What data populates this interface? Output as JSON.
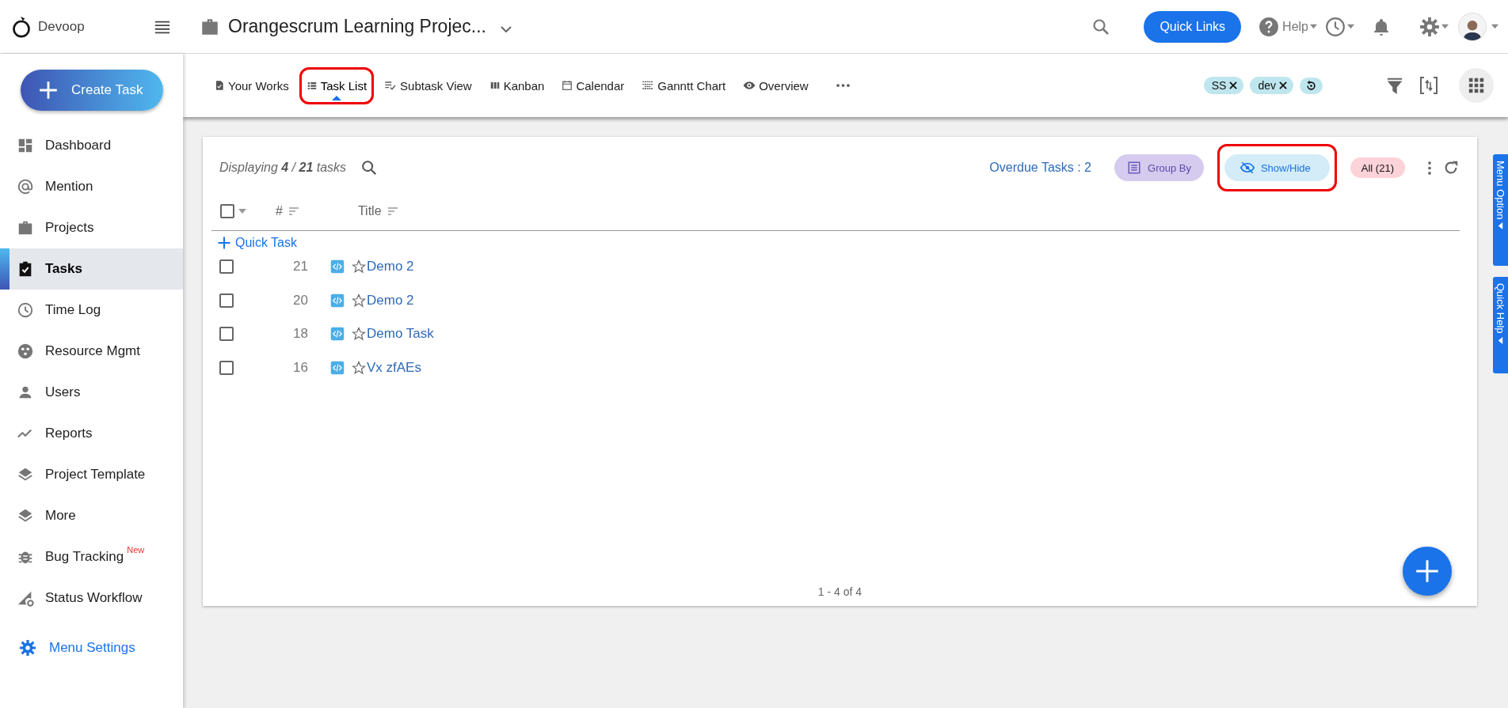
{
  "app": {
    "name": "Devoop"
  },
  "topbar": {
    "project_title": "Orangescrum Learning Projec...",
    "quick_links": "Quick Links",
    "help": "Help"
  },
  "sidebar": {
    "create_button": "Create Task",
    "items": [
      {
        "label": "Dashboard",
        "selected": false
      },
      {
        "label": "Mention",
        "selected": false
      },
      {
        "label": "Projects",
        "selected": false
      },
      {
        "label": "Tasks",
        "selected": true
      },
      {
        "label": "Time Log",
        "selected": false
      },
      {
        "label": "Resource Mgmt",
        "selected": false
      },
      {
        "label": "Users",
        "selected": false
      },
      {
        "label": "Reports",
        "selected": false
      },
      {
        "label": "Project Template",
        "selected": false
      },
      {
        "label": "More",
        "selected": false
      },
      {
        "label": "Bug Tracking",
        "badge": "New",
        "selected": false
      },
      {
        "label": "Status Workflow",
        "selected": false
      }
    ],
    "settings": "Menu Settings"
  },
  "view_tabs": [
    {
      "label": "Your Works",
      "selected": false,
      "circled": false
    },
    {
      "label": "Task List",
      "selected": true,
      "circled": true
    },
    {
      "label": "Subtask View",
      "selected": false,
      "circled": false
    },
    {
      "label": "Kanban",
      "selected": false,
      "circled": false
    },
    {
      "label": "Calendar",
      "selected": false,
      "circled": false
    },
    {
      "label": "Ganntt Chart",
      "selected": false,
      "circled": false
    },
    {
      "label": "Overview",
      "selected": false,
      "circled": false
    }
  ],
  "filter_chips": [
    {
      "label": "SS"
    },
    {
      "label": "dev"
    }
  ],
  "task_panel": {
    "summary": "Displaying **4** / **21** tasks",
    "overdue": "Overdue Tasks : 2",
    "actions": [
      {
        "label": "Group By",
        "kind": "group",
        "circled": false
      },
      {
        "label": "Show/Hide",
        "kind": "showhide",
        "circled": true
      },
      {
        "label": "All (21)",
        "kind": "all",
        "circled": false
      }
    ],
    "select_all": {
      "checked": false
    },
    "columns": [
      {
        "label": "#"
      },
      {
        "label": "Title"
      }
    ],
    "quick_task": "Quick Task",
    "rows": [
      {
        "number": "21",
        "title": "Demo 2",
        "checked": false,
        "starred": false
      },
      {
        "number": "20",
        "title": "Demo 2",
        "checked": false,
        "starred": false
      },
      {
        "number": "18",
        "title": "Demo Task",
        "checked": false,
        "starred": false
      },
      {
        "number": "16",
        "title": "Vx zfAEs",
        "checked": false,
        "starred": false
      }
    ],
    "pagination": "1 - 4 of 4"
  },
  "side_tabs": [
    {
      "label": "Menu Option"
    },
    {
      "label": "Quick Help"
    }
  ]
}
